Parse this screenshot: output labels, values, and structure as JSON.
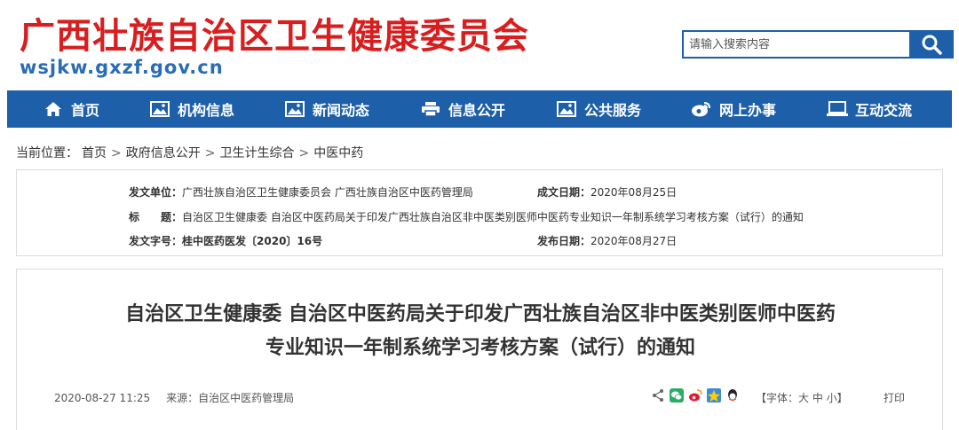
{
  "header": {
    "site_title": "广西壮族自治区卫生健康委员会",
    "site_url": "wsjkw.gxzf.gov.cn",
    "search_placeholder": "请输入搜索内容"
  },
  "nav": {
    "items": [
      {
        "label": "首页",
        "icon": "home-icon"
      },
      {
        "label": "机构信息",
        "icon": "picture-icon"
      },
      {
        "label": "新闻动态",
        "icon": "picture-icon"
      },
      {
        "label": "信息公开",
        "icon": "printer-icon"
      },
      {
        "label": "公共服务",
        "icon": "picture-icon"
      },
      {
        "label": "网上办事",
        "icon": "weibo-icon"
      },
      {
        "label": "互动交流",
        "icon": "laptop-icon"
      }
    ]
  },
  "breadcrumb": {
    "prefix": "当前位置：",
    "items": [
      "首页",
      "政府信息公开",
      "卫生计生综合",
      "中医中药"
    ],
    "separator": ">"
  },
  "meta": {
    "issuer_label": "发文单位：",
    "issuer_value": "广西壮族自治区卫生健康委员会  广西壮族自治区中医药管理局",
    "created_label": "成文日期：",
    "created_value": "2020年08月25日",
    "title_label": "标　　题：",
    "title_value": "自治区卫生健康委 自治区中医药局关于印发广西壮族自治区非中医类别医师中医药专业知识一年制系统学习考核方案（试行）的通知",
    "doc_no_label": "发文字号：",
    "doc_no_value": "桂中医药医发〔2020〕16号",
    "published_label": "发布日期：",
    "published_value": "2020年08月27日"
  },
  "article": {
    "title_line1": "自治区卫生健康委  自治区中医药局关于印发广西壮族自治区非中医类别医师中医药",
    "title_line2": "专业知识一年制系统学习考核方案（试行）的通知",
    "datetime": "2020-08-27 11:25",
    "source": "来源：自治区中医药管理局",
    "font_size_label": "【字体：大 中 小】",
    "print_label": "打印"
  },
  "colors": {
    "brand_red": "#d81e1e",
    "brand_blue": "#1d5fa8"
  }
}
